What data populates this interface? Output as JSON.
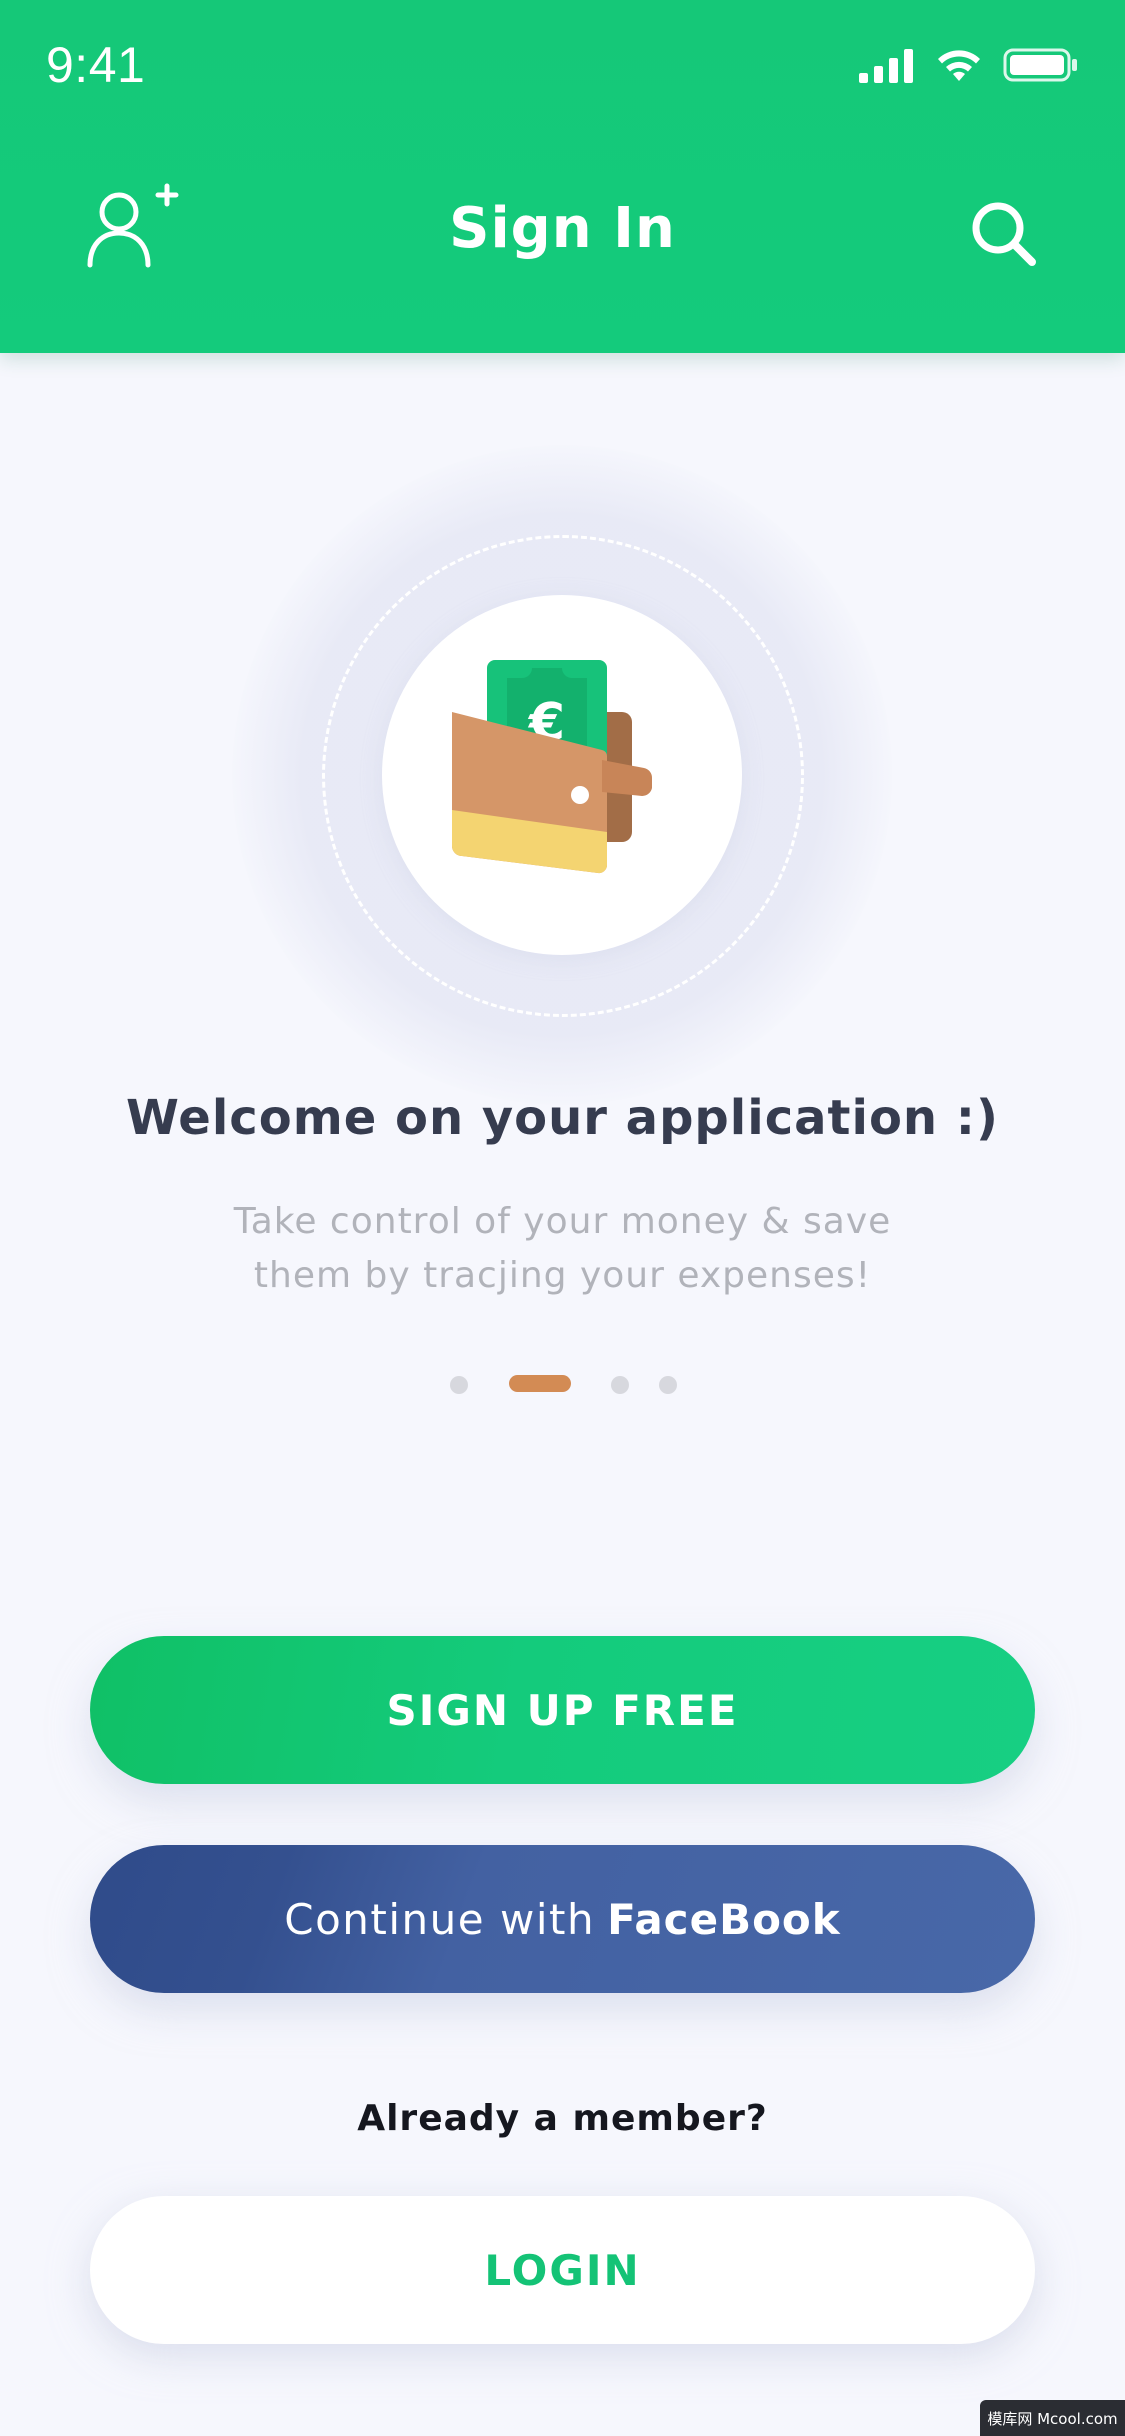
{
  "status_bar": {
    "time": "9:41"
  },
  "header": {
    "title": "Sign In",
    "left_icon": "add-user-icon",
    "right_icon": "search-icon",
    "background_color": "#14c97a"
  },
  "onboarding": {
    "illustration": "wallet-euro-icon",
    "title": "Welcome on your application :)",
    "subtitle": "Take control of your money & save them by tracjing your expenses!",
    "pager": {
      "total": 4,
      "active_index": 1
    }
  },
  "actions": {
    "signup_label": "SIGN UP FREE",
    "facebook_prefix": "Continue with",
    "facebook_brand": "FaceBook",
    "member_prompt": "Already a member?",
    "login_label": "LOGIN"
  },
  "watermark": "模库网 Mcool.com",
  "colors": {
    "accent_green": "#14c97a",
    "facebook_blue": "#4464a5",
    "pager_active": "#d38b54",
    "title_text": "#363c4f",
    "subtitle_text": "#b1b3ba"
  }
}
